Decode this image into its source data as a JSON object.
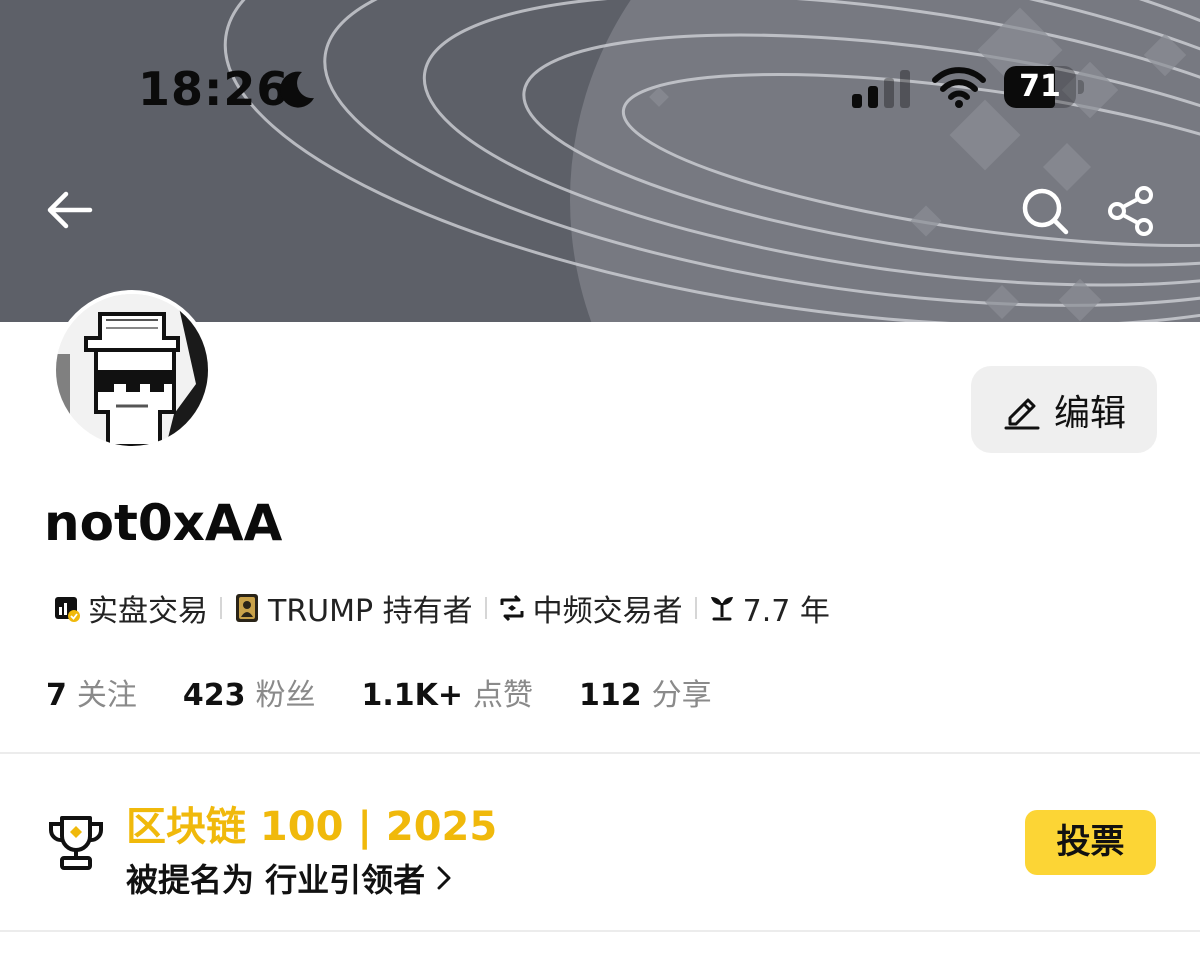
{
  "status_bar": {
    "time": "18:26",
    "battery": "71",
    "battery_level": 0.71,
    "icons": [
      "moon-icon",
      "cellular-signal-icon",
      "wifi-icon",
      "battery-icon"
    ]
  },
  "header": {
    "icons": [
      "back-arrow-icon",
      "search-icon",
      "share-icon"
    ]
  },
  "profile": {
    "username": "not0xAA",
    "edit_label": "编辑",
    "tags": [
      {
        "label": "实盘交易",
        "icon": "live-trading-icon"
      },
      {
        "label": "TRUMP 持有者",
        "icon": "trump-token-icon"
      },
      {
        "label": "中频交易者",
        "icon": "mid-frequency-icon"
      },
      {
        "label": "7.7 年",
        "icon": "sprout-icon"
      }
    ],
    "stats": [
      {
        "value": "7",
        "label": "关注"
      },
      {
        "value": "423",
        "label": "粉丝"
      },
      {
        "value": "1.1K+",
        "label": "点赞"
      },
      {
        "value": "112",
        "label": "分享"
      }
    ]
  },
  "award": {
    "title": "区块链 100 | 2025",
    "subtitle": "被提名为 行业引领者",
    "vote_label": "投票",
    "icon": "trophy-icon"
  },
  "colors": {
    "banner": "#5d6068",
    "accent_yellow": "#f0b90b",
    "vote_button": "#fcd535",
    "edit_button": "#efefef",
    "muted_text": "#8a8a8a"
  }
}
